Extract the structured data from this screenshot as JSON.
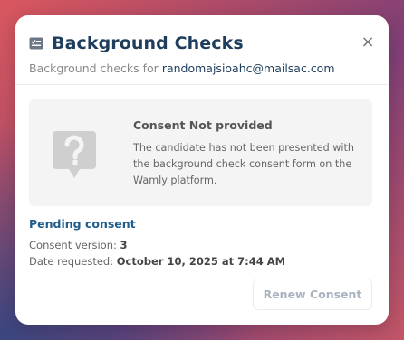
{
  "modal": {
    "title": "Background Checks",
    "subtitle_prefix": "Background checks for",
    "email": "randomajsioahc@mailsac.com",
    "close_label": "×"
  },
  "consent": {
    "title": "Consent Not provided",
    "description": "The candidate has not been presented with the background check consent form on the Wamly platform.",
    "icon": "question-bubble-icon"
  },
  "status": {
    "label": "Pending consent",
    "version_label": "Consent version:",
    "version_value": "3",
    "date_label": "Date requested:",
    "date_value": "October 10, 2025 at 7:44 AM"
  },
  "actions": {
    "renew_label": "Renew Consent"
  },
  "colors": {
    "title": "#1f3d5c",
    "pending": "#1f5d8c",
    "disabled_button_text": "#a8b3bf"
  }
}
